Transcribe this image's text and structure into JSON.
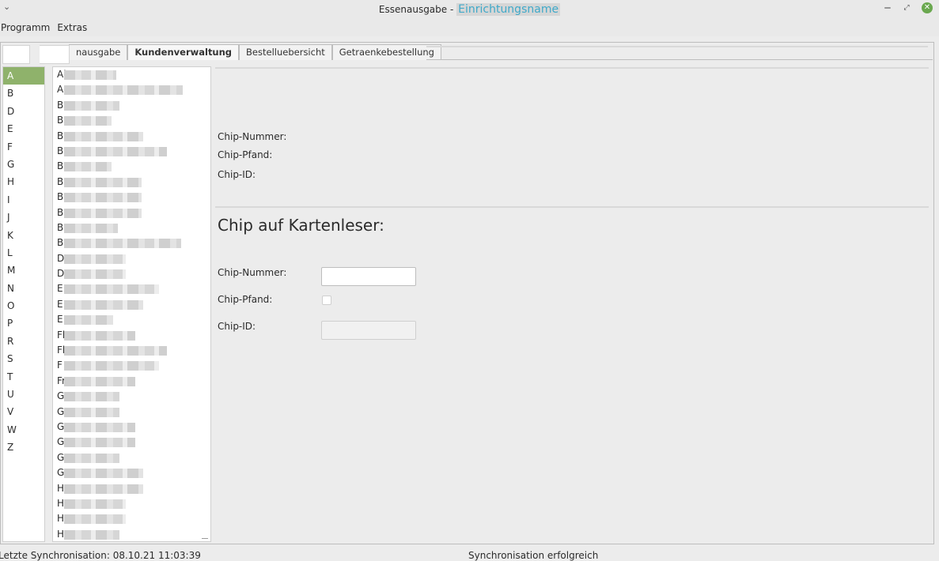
{
  "window": {
    "title_prefix": "Essenausgabe - ",
    "title_name": "Einrichtungsname",
    "menu_chevron": "⌄",
    "minimize": "‒",
    "maximize": "⤢",
    "close": "✕"
  },
  "menubar": {
    "items": [
      "Programm",
      "Extras"
    ]
  },
  "tabs": [
    {
      "label": "nausgabe",
      "active": false
    },
    {
      "label": "Kundenverwaltung",
      "active": true
    },
    {
      "label": "Bestelluebersicht",
      "active": false
    },
    {
      "label": "Getraenkebestellung",
      "active": false
    }
  ],
  "letters": {
    "selected": "A",
    "items": [
      "A",
      "B",
      "D",
      "E",
      "F",
      "G",
      "H",
      "I",
      "J",
      "K",
      "L",
      "M",
      "N",
      "O",
      "P",
      "R",
      "S",
      "T",
      "U",
      "V",
      "W",
      "Z"
    ]
  },
  "customers": [
    "Al",
    "Au",
    "B",
    "B",
    "B",
    "B",
    "B",
    "B",
    "B",
    "B",
    "B",
    "B",
    "D",
    "D",
    "E",
    "E",
    "E",
    "Fl",
    "Fl",
    "F",
    "Fr",
    "G",
    "G",
    "G",
    "G",
    "G",
    "G",
    "H",
    "H",
    "H",
    "H"
  ],
  "chip_info": {
    "number_label": "Chip-Nummer:",
    "deposit_label": "Chip-Pfand:",
    "id_label": "Chip-ID:"
  },
  "card_reader": {
    "heading": "Chip auf Kartenleser:",
    "number_label": "Chip-Nummer:",
    "number_value": "",
    "deposit_label": "Chip-Pfand:",
    "deposit_checked": false,
    "id_label": "Chip-ID:",
    "id_value": ""
  },
  "status": {
    "last_sync": "Letzte Synchronisation: 08.10.21 11:03:39",
    "sync_state": "Synchronisation erfolgreich"
  }
}
